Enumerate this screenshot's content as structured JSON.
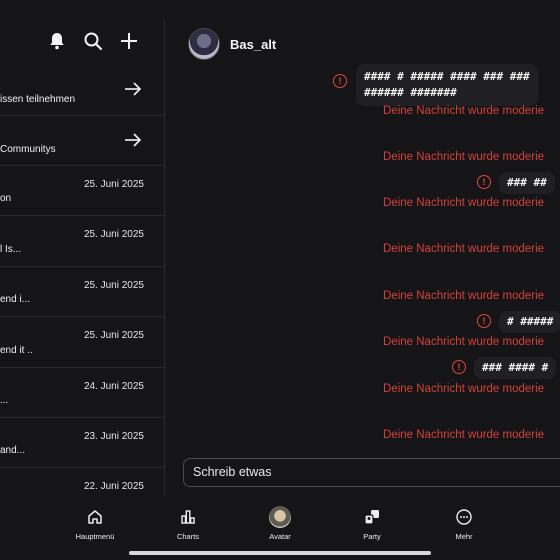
{
  "left_panel": {
    "action_rows": [
      {
        "label": "issen teilnehmen"
      },
      {
        "label": " Communitys"
      }
    ],
    "conversations": [
      {
        "date": "25. Juni 2025",
        "snippet": "on"
      },
      {
        "date": "25. Juni 2025",
        "snippet": "l Is..."
      },
      {
        "date": "25. Juni 2025",
        "snippet": "end i..."
      },
      {
        "date": "25. Juni 2025",
        "snippet": "end it .."
      },
      {
        "date": "24. Juni 2025",
        "snippet": "..."
      },
      {
        "date": "23. Juni 2025",
        "snippet": "and..."
      },
      {
        "date": "22. Juni 2025",
        "snippet": ""
      }
    ]
  },
  "chat": {
    "name": "Bas_alt",
    "messages": [
      {
        "bubble": "#### # ##### #### ### ###\n###### #######",
        "moderated": "Deine Nachricht wurde moderie"
      },
      {
        "bubble": "",
        "moderated": "Deine Nachricht wurde moderie"
      },
      {
        "bubble": "### ##",
        "moderated": "Deine Nachricht wurde moderie"
      },
      {
        "bubble": "",
        "moderated": "Deine Nachricht wurde moderie"
      },
      {
        "bubble": "",
        "moderated": "Deine Nachricht wurde moderie"
      },
      {
        "bubble": "# #####",
        "moderated": "Deine Nachricht wurde moderie"
      },
      {
        "bubble": "### #### #",
        "moderated": "Deine Nachricht wurde moderie"
      },
      {
        "bubble": "",
        "moderated": "Deine Nachricht wurde moderie"
      }
    ],
    "input_placeholder": "Schreib etwas"
  },
  "nav": {
    "items": [
      {
        "label": "Hauptmenü",
        "icon": "home-icon"
      },
      {
        "label": "Charts",
        "icon": "charts-icon"
      },
      {
        "label": "Avatar",
        "icon": "avatar-icon"
      },
      {
        "label": "Party",
        "icon": "party-icon"
      },
      {
        "label": "Mehr",
        "icon": "more-icon"
      }
    ]
  },
  "colors": {
    "background": "#151517",
    "moderation_red": "#d4413b",
    "bubble": "#202024"
  }
}
